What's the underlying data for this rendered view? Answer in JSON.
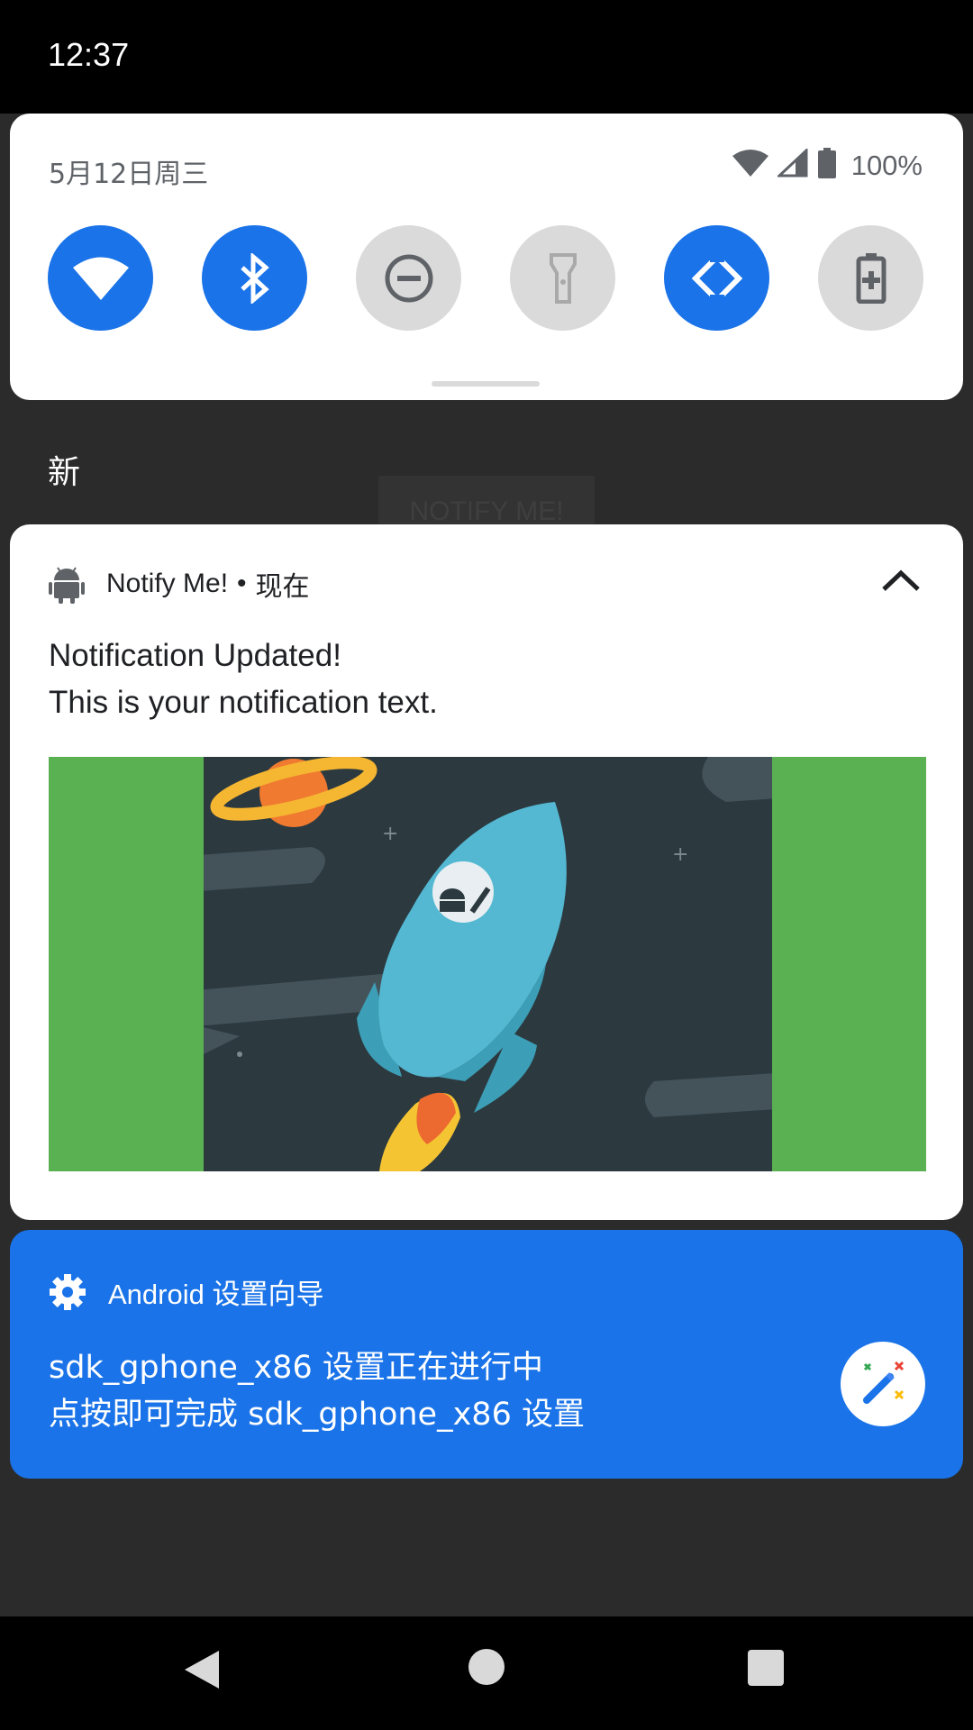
{
  "status_bar": {
    "time": "12:37"
  },
  "quick_settings": {
    "date": "5月12日周三",
    "battery_percent": "100%",
    "tiles": [
      {
        "name": "wifi",
        "state": "on"
      },
      {
        "name": "bluetooth",
        "state": "on"
      },
      {
        "name": "do-not-disturb",
        "state": "off"
      },
      {
        "name": "flashlight",
        "state": "off"
      },
      {
        "name": "auto-rotate",
        "state": "on"
      },
      {
        "name": "battery-saver",
        "state": "off"
      }
    ]
  },
  "section": {
    "label": "新"
  },
  "background_app": {
    "button_label": "NOTIFY ME!"
  },
  "notification": {
    "app_name": "Notify Me!",
    "separator": "•",
    "time": "现在",
    "title": "Notification Updated!",
    "text": "This is your notification text.",
    "image_icon": "rocket-illustration"
  },
  "setup_notification": {
    "app_name": "Android 设置向导",
    "line1": "sdk_gphone_x86 设置正在进行中",
    "line2": "点按即可完成 sdk_gphone_x86 设置",
    "icon": "magic-wand-icon"
  },
  "colors": {
    "accent": "#1a73e8",
    "image_bg": "#5ab152",
    "space": "#2c3a40",
    "rocket": "#54b8d2"
  }
}
